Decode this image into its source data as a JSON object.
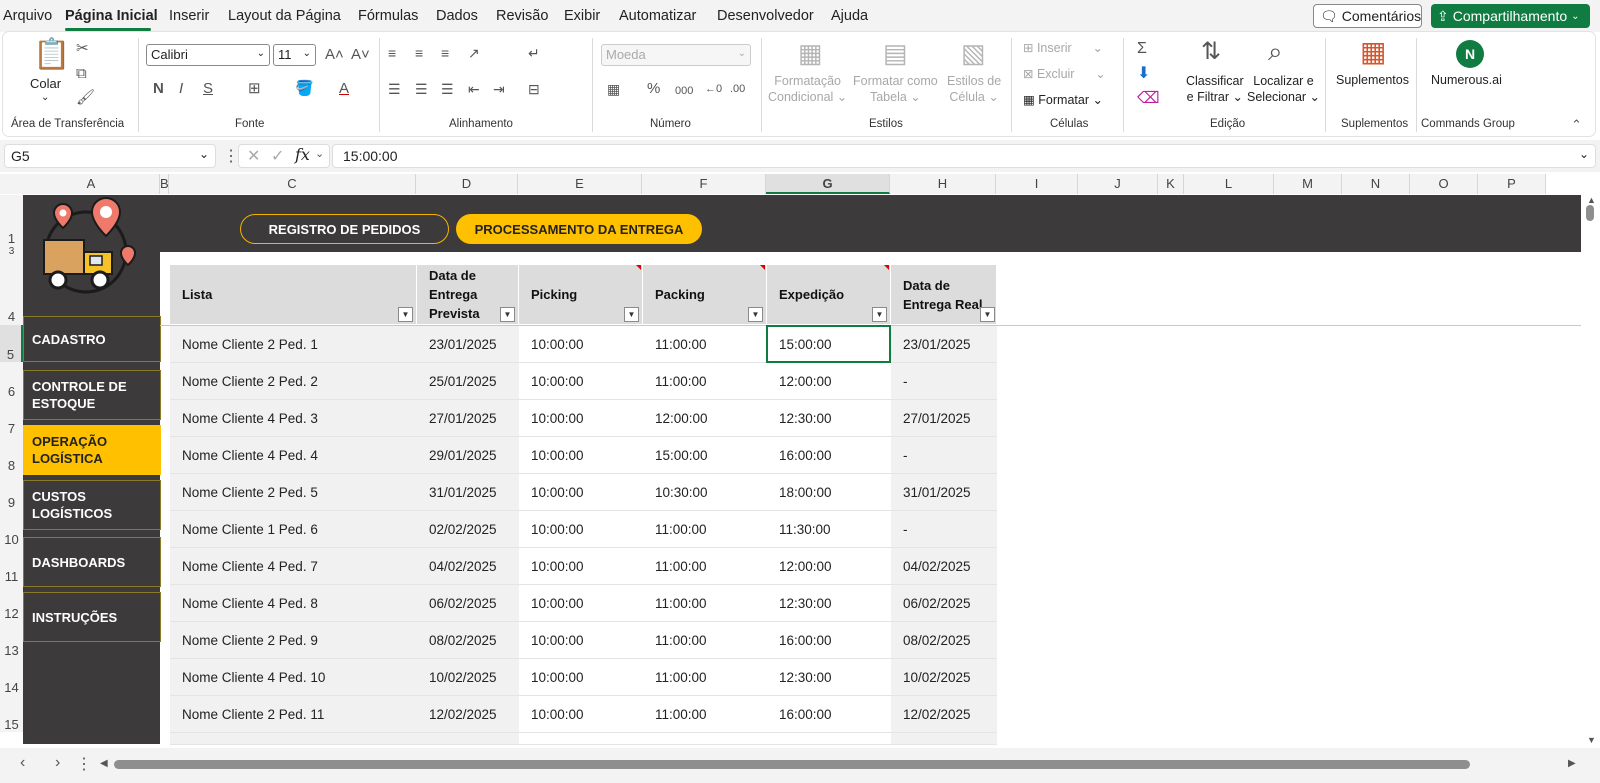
{
  "menu": {
    "items": [
      "Arquivo",
      "Página Inicial",
      "Inserir",
      "Layout da Página",
      "Fórmulas",
      "Dados",
      "Revisão",
      "Exibir",
      "Automatizar",
      "Desenvolvedor",
      "Ajuda"
    ],
    "comments": "Comentários",
    "share": "Compartilhamento"
  },
  "ribbon": {
    "paste": "Colar",
    "font_name": "Calibri",
    "font_size": "11",
    "number_format": "Moeda",
    "cond_format": [
      "Formatação",
      "Condicional"
    ],
    "format_table": [
      "Formatar como",
      "Tabela"
    ],
    "cell_styles": [
      "Estilos de",
      "Célula"
    ],
    "insert": "Inserir",
    "delete": "Excluir",
    "format": "Formatar",
    "sort": [
      "Classificar",
      "e Filtrar"
    ],
    "find": [
      "Localizar e",
      "Selecionar"
    ],
    "addins": "Suplementos",
    "numerous": "Numerous.ai",
    "groups": {
      "clipboard": "Área de Transferência",
      "font": "Fonte",
      "alignment": "Alinhamento",
      "number": "Número",
      "styles": "Estilos",
      "cells": "Células",
      "editing": "Edição",
      "addins": "Suplementos",
      "commands": "Commands Group"
    }
  },
  "formula_bar": {
    "name_box": "G5",
    "formula": "15:00:00"
  },
  "columns": [
    "A",
    "B",
    "C",
    "D",
    "E",
    "F",
    "G",
    "H",
    "I",
    "J",
    "K",
    "L",
    "M",
    "N",
    "O",
    "P"
  ],
  "rows": [
    "1",
    "3",
    "4",
    "5",
    "6",
    "7",
    "8",
    "9",
    "10",
    "11",
    "12",
    "13",
    "14",
    "15"
  ],
  "tabs": {
    "registro": "REGISTRO DE PEDIDOS",
    "processamento": "PROCESSAMENTO DA ENTREGA"
  },
  "nav": [
    "CADASTRO",
    "CONTROLE DE ESTOQUE",
    "OPERAÇÃO LOGÍSTICA",
    "CUSTOS LOGÍSTICOS",
    "DASHBOARDS",
    "INSTRUÇÕES"
  ],
  "table": {
    "headers": [
      "Lista",
      "Data de Entrega Prevista",
      "Picking",
      "Packing",
      "Expedição",
      "Data de Entrega Real"
    ],
    "rows": [
      [
        "Nome Cliente 2 Ped. 1",
        "23/01/2025",
        "10:00:00",
        "11:00:00",
        "15:00:00",
        "23/01/2025"
      ],
      [
        "Nome Cliente 2 Ped. 2",
        "25/01/2025",
        "10:00:00",
        "11:00:00",
        "12:00:00",
        "-"
      ],
      [
        "Nome Cliente 4 Ped. 3",
        "27/01/2025",
        "10:00:00",
        "12:00:00",
        "12:30:00",
        "27/01/2025"
      ],
      [
        "Nome Cliente 4 Ped. 4",
        "29/01/2025",
        "10:00:00",
        "15:00:00",
        "16:00:00",
        "-"
      ],
      [
        "Nome Cliente 2 Ped. 5",
        "31/01/2025",
        "10:00:00",
        "10:30:00",
        "18:00:00",
        "31/01/2025"
      ],
      [
        "Nome Cliente 1 Ped. 6",
        "02/02/2025",
        "10:00:00",
        "11:00:00",
        "11:30:00",
        "-"
      ],
      [
        "Nome Cliente 4 Ped. 7",
        "04/02/2025",
        "10:00:00",
        "11:00:00",
        "12:00:00",
        "04/02/2025"
      ],
      [
        "Nome Cliente 4 Ped. 8",
        "06/02/2025",
        "10:00:00",
        "11:00:00",
        "12:30:00",
        "06/02/2025"
      ],
      [
        "Nome Cliente 2 Ped. 9",
        "08/02/2025",
        "10:00:00",
        "11:00:00",
        "16:00:00",
        "08/02/2025"
      ],
      [
        "Nome Cliente 4 Ped. 10",
        "10/02/2025",
        "10:00:00",
        "11:00:00",
        "12:30:00",
        "10/02/2025"
      ],
      [
        "Nome Cliente 2 Ped. 11",
        "12/02/2025",
        "10:00:00",
        "11:00:00",
        "16:00:00",
        "12/02/2025"
      ]
    ]
  },
  "colors": {
    "accent": "#ffc000",
    "dark": "#3c3a3a",
    "excel_green": "#107c41"
  }
}
